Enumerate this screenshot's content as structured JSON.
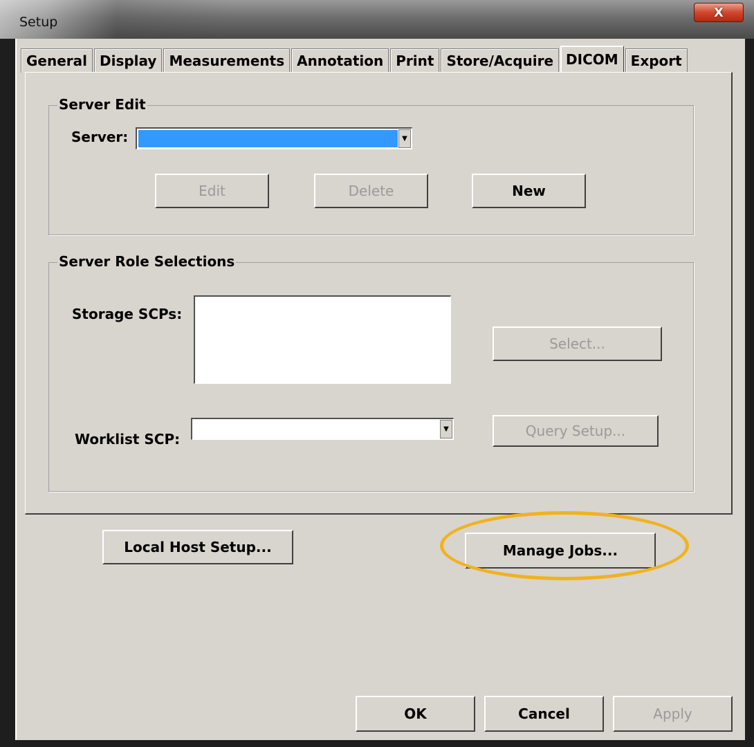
{
  "window": {
    "title": "Setup",
    "close_glyph": "X"
  },
  "tabs": [
    {
      "label": "General",
      "active": false
    },
    {
      "label": "Display",
      "active": false
    },
    {
      "label": "Measurements",
      "active": false
    },
    {
      "label": "Annotation",
      "active": false
    },
    {
      "label": "Print",
      "active": false
    },
    {
      "label": "Store/Acquire",
      "active": false
    },
    {
      "label": "DICOM",
      "active": true
    },
    {
      "label": "Export",
      "active": false
    }
  ],
  "server_edit": {
    "legend": "Server Edit",
    "server_label": "Server:",
    "server_value": "",
    "edit_label": "Edit",
    "delete_label": "Delete",
    "new_label": "New"
  },
  "server_roles": {
    "legend": "Server Role Selections",
    "storage_label": "Storage SCPs:",
    "select_label": "Select...",
    "worklist_label": "Worklist SCP:",
    "worklist_value": "",
    "query_setup_label": "Query Setup..."
  },
  "actions": {
    "local_host_label": "Local Host Setup...",
    "manage_jobs_label": "Manage Jobs..."
  },
  "footer": {
    "ok_label": "OK",
    "cancel_label": "Cancel",
    "apply_label": "Apply"
  },
  "colors": {
    "dialog_bg": "#d8d4ce",
    "selection": "#3399ff",
    "highlight": "#f1b21e",
    "close_button": "#d0472c"
  }
}
